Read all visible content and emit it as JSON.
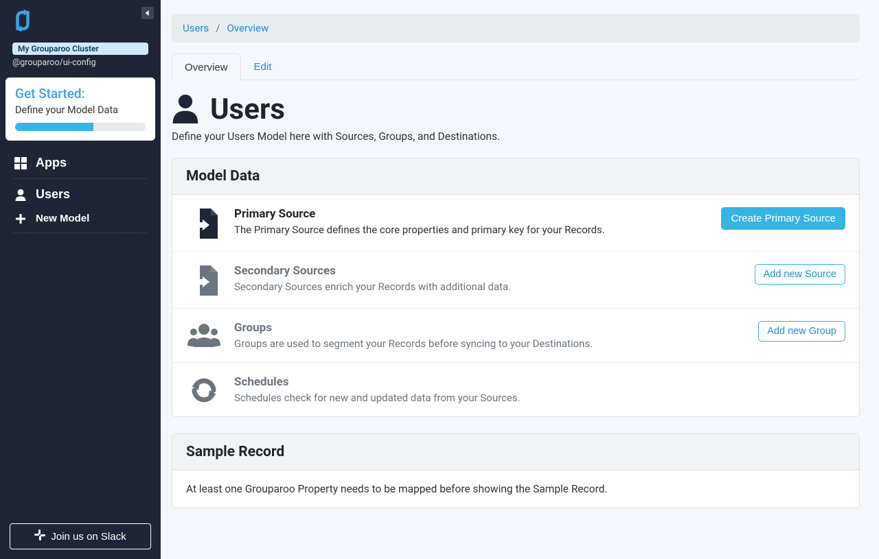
{
  "sidebar": {
    "cluster_badge": "My Grouparoo Cluster",
    "package": "@grouparoo/ui-config",
    "get_started": {
      "title": "Get Started:",
      "subtitle": "Define your Model Data",
      "progress_pct": 60
    },
    "items": {
      "apps": "Apps",
      "users": "Users",
      "new_model": "New Model"
    },
    "slack": "Join us on Slack"
  },
  "breadcrumb": {
    "users": "Users",
    "overview": "Overview"
  },
  "tabs": {
    "overview": "Overview",
    "edit": "Edit"
  },
  "page": {
    "title": "Users",
    "description": "Define your Users Model here with Sources, Groups, and Destinations."
  },
  "model_data": {
    "heading": "Model Data",
    "primary": {
      "title": "Primary Source",
      "desc": "The Primary Source defines the core properties and primary key for your Records.",
      "action": "Create Primary Source"
    },
    "secondary": {
      "title": "Secondary Sources",
      "desc": "Secondary Sources enrich your Records with additional data.",
      "action": "Add new Source"
    },
    "groups": {
      "title": "Groups",
      "desc": "Groups are used to segment your Records before syncing to your Destinations.",
      "action": "Add new Group"
    },
    "schedules": {
      "title": "Schedules",
      "desc": "Schedules check for new and updated data from your Sources."
    }
  },
  "sample_record": {
    "heading": "Sample Record",
    "body": "At least one Grouparoo Property needs to be mapped before showing the Sample Record."
  }
}
